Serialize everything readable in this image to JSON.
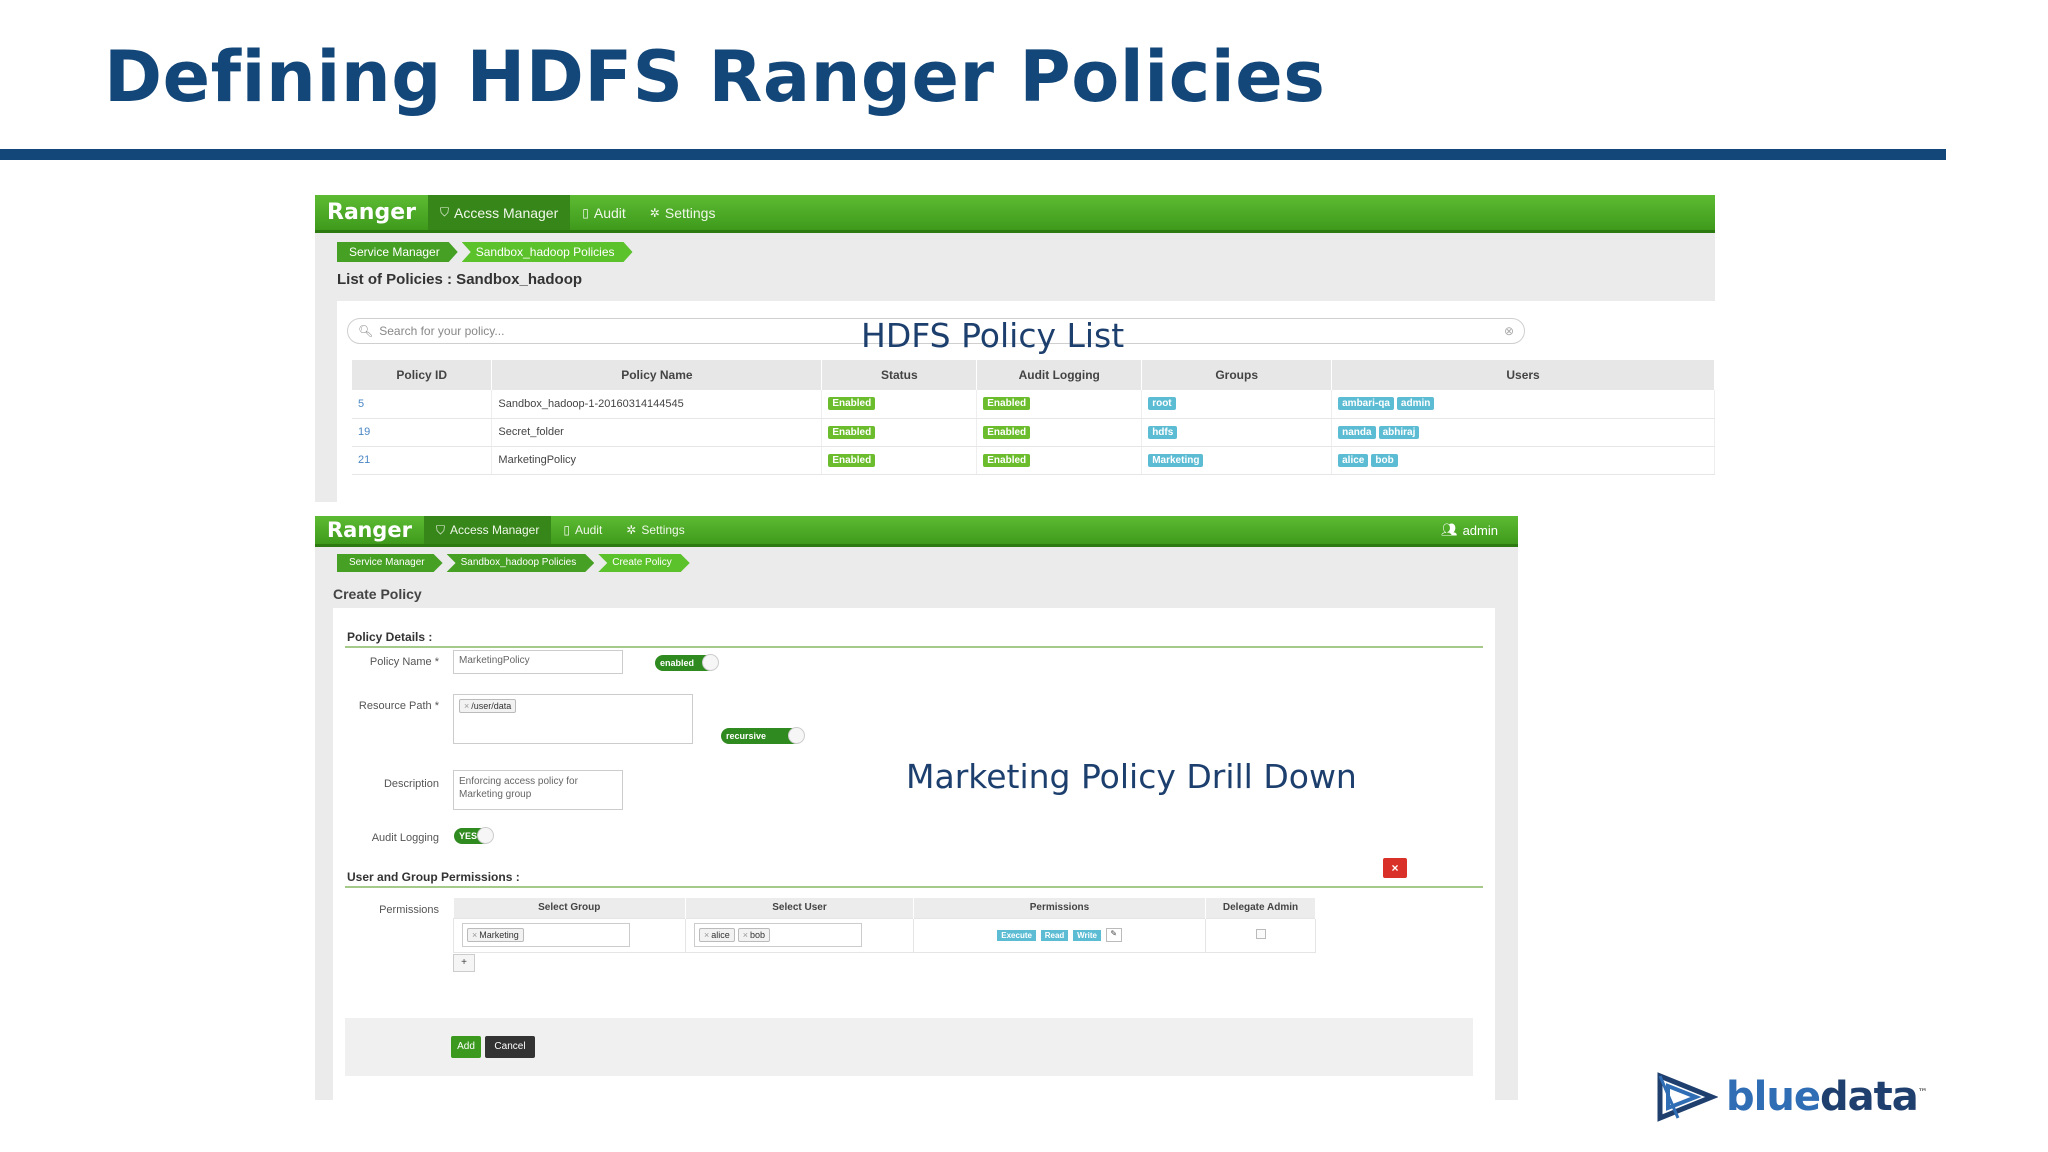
{
  "slide": {
    "title": "Defining HDFS Ranger Policies",
    "label_list": "HDFS Policy List",
    "label_drilldown": "Marketing Policy Drill Down",
    "logo": {
      "text_dark": "blue",
      "text_light": "data",
      "tm": "™"
    },
    "colors": {
      "title": "#13477a",
      "ranger_green": "#46a023",
      "label_teal": "#5cbcd3",
      "danger": "#d9302a"
    }
  },
  "list_screen": {
    "nav": {
      "brand": "Ranger",
      "access_manager": "Access Manager",
      "audit": "Audit",
      "settings": "Settings"
    },
    "breadcrumbs": [
      "Service Manager",
      "Sandbox_hadoop Policies"
    ],
    "heading": "List of Policies : Sandbox_hadoop",
    "search_placeholder": "Search for your policy...",
    "columns": [
      "Policy ID",
      "Policy Name",
      "Status",
      "Audit Logging",
      "Groups",
      "Users"
    ],
    "rows": [
      {
        "id": "5",
        "name": "Sandbox_hadoop-1-20160314144545",
        "status": "Enabled",
        "audit": "Enabled",
        "groups": [
          "root"
        ],
        "users": [
          "ambari-qa",
          "admin"
        ]
      },
      {
        "id": "19",
        "name": "Secret_folder",
        "status": "Enabled",
        "audit": "Enabled",
        "groups": [
          "hdfs"
        ],
        "users": [
          "nanda",
          "abhiraj"
        ]
      },
      {
        "id": "21",
        "name": "MarketingPolicy",
        "status": "Enabled",
        "audit": "Enabled",
        "groups": [
          "Marketing"
        ],
        "users": [
          "alice",
          "bob"
        ]
      }
    ]
  },
  "create_screen": {
    "nav": {
      "brand": "Ranger",
      "access_manager": "Access Manager",
      "audit": "Audit",
      "settings": "Settings",
      "user": "admin"
    },
    "breadcrumbs": [
      "Service Manager",
      "Sandbox_hadoop Policies",
      "Create Policy"
    ],
    "heading": "Create Policy",
    "policy_details_title": "Policy Details :",
    "policy_name_label": "Policy Name *",
    "policy_name_value": "MarketingPolicy",
    "enabled_toggle": "enabled",
    "resource_path_label": "Resource Path *",
    "resource_path_tag": "/user/data",
    "recursive_toggle": "recursive",
    "description_label": "Description",
    "description_value": "Enforcing access policy for Marketing group",
    "audit_logging_label": "Audit Logging",
    "audit_toggle": "YES",
    "permissions_section_title": "User and Group Permissions :",
    "permissions_label": "Permissions",
    "perm_columns": [
      "Select Group",
      "Select User",
      "Permissions",
      "Delegate Admin"
    ],
    "perm_row": {
      "group": "Marketing",
      "users": [
        "alice",
        "bob"
      ],
      "permissions": [
        "Execute",
        "Read",
        "Write"
      ]
    },
    "add_row": "+",
    "delete": "×",
    "add_button": "Add",
    "cancel_button": "Cancel"
  }
}
